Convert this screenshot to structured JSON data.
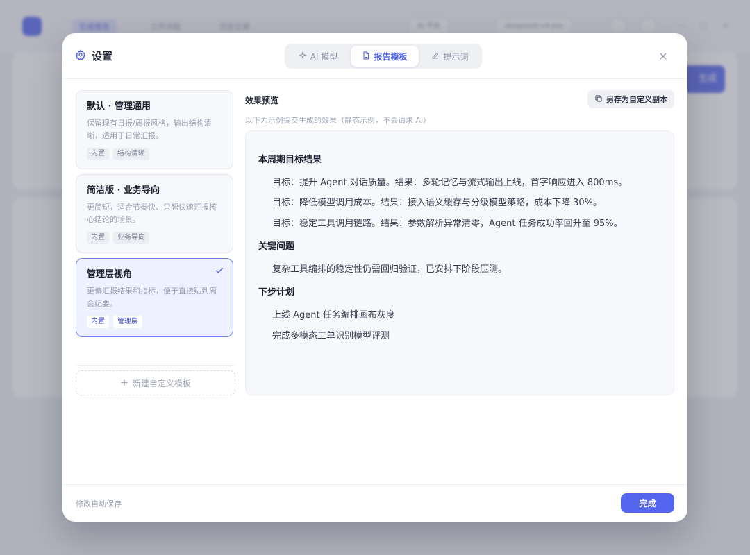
{
  "background": {
    "tabs": [
      "生成报告",
      "工作流程",
      "历史记录"
    ],
    "pill_left": "AI 平台",
    "pill_model": "deepseek-v4-pro",
    "action_button": "生成"
  },
  "modal": {
    "title": "设置",
    "tabs": [
      {
        "label": "AI 模型",
        "icon": "sparkle-icon",
        "active": false
      },
      {
        "label": "报告模板",
        "icon": "document-icon",
        "active": true
      },
      {
        "label": "提示词",
        "icon": "pencil-icon",
        "active": false
      }
    ],
    "templates": [
      {
        "name": "默认 · 管理通用",
        "desc": "保留现有日报/周报风格，输出结构清晰，适用于日常汇报。",
        "tags": [
          "内置",
          "结构清晰"
        ],
        "selected": false
      },
      {
        "name": "简洁版 · 业务导向",
        "desc": "更简短，适合节奏快、只想快速汇报核心结论的场景。",
        "tags": [
          "内置",
          "业务导向"
        ],
        "selected": false
      },
      {
        "name": "管理层视角",
        "desc": "更偏汇报结果和指标，便于直接贴到周会纪要。",
        "tags": [
          "内置",
          "管理层"
        ],
        "selected": true
      }
    ],
    "new_template_label": "新建自定义模板",
    "preview": {
      "title": "效果预览",
      "subtitle": "以下为示例提交生成的效果（静态示例，不会请求 AI）",
      "save_copy_label": "另存为自定义副本",
      "sections": [
        {
          "heading": "本周期目标结果",
          "lines": [
            "目标：提升 Agent 对话质量。结果：多轮记忆与流式输出上线，首字响应进入 800ms。",
            "目标：降低模型调用成本。结果：接入语义缓存与分级模型策略，成本下降 30%。",
            "目标：稳定工具调用链路。结果：参数解析异常清零，Agent 任务成功率回升至 95%。"
          ]
        },
        {
          "heading": "关键问题",
          "lines": [
            "复杂工具编排的稳定性仍需回归验证，已安排下阶段压测。"
          ]
        },
        {
          "heading": "下步计划",
          "lines": [
            "上线 Agent 任务编排画布灰度",
            "完成多模态工单识别模型评测"
          ]
        }
      ]
    },
    "footer": {
      "autosave": "修改自动保存",
      "done_label": "完成"
    }
  },
  "colors": {
    "accent": "#5566ee",
    "selected_bg": "#eef1ff",
    "selected_border": "#6e7ef0"
  }
}
